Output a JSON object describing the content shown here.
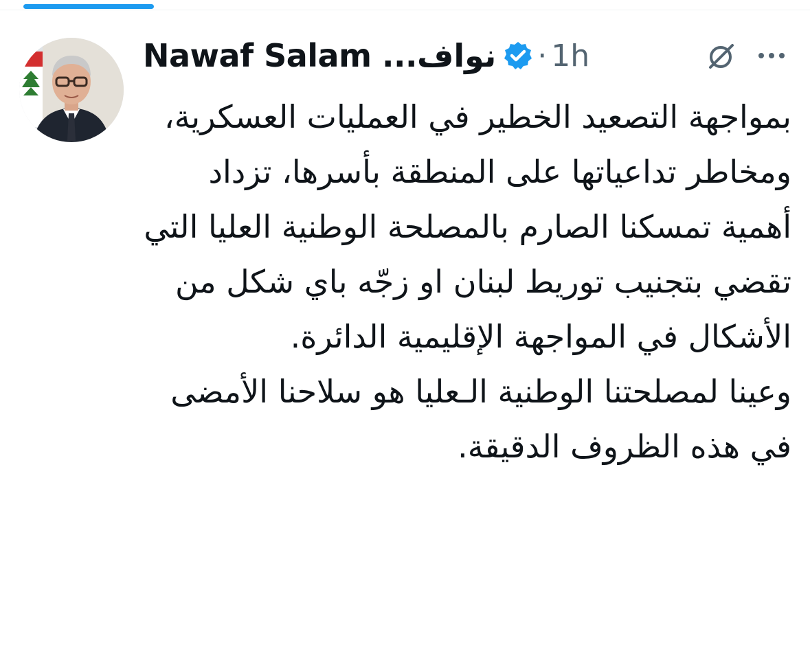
{
  "post": {
    "author_name": "Nawaf Salam ...نواف",
    "separator": "·",
    "time_ago": "1h",
    "text": "بمواجهة التصعيد الخطير في العمليات العسكرية، ومخاطر تداعياتها على المنطقة بأسرها، تزداد أهمية تمسكنا الصارم بالمصلحة الوطنية العليا التي تقضي بتجنيب توريط لبنان او زجّه باي شكل من الأشكال في المواجهة الإقليمية الدائرة.\nوعينا لمصلحتنا الوطنية الـعليا هو سلاحنا الأمضى في هذه الظروف الدقيقة."
  },
  "icons": {
    "verified": "verified-badge-icon",
    "grok": "grok-icon",
    "more": "more-horizontal-icon"
  },
  "colors": {
    "accent": "#1d9bf0",
    "text": "#0f1419",
    "secondary": "#536471"
  }
}
